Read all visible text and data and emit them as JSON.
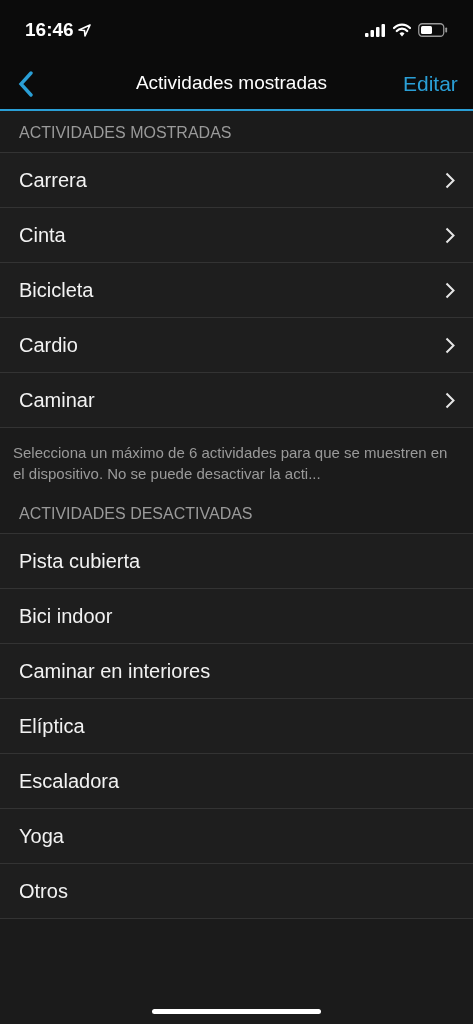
{
  "status_bar": {
    "time": "16:46"
  },
  "nav_bar": {
    "title": "Actividades mostradas",
    "action": "Editar"
  },
  "sections": [
    {
      "header": "ACTIVIDADES MOSTRADAS",
      "footer": "Selecciona un máximo de 6 actividades para que se muestren en el dispositivo. No se puede desactivar la acti...",
      "items": [
        {
          "label": "Carrera",
          "kind": "link"
        },
        {
          "label": "Cinta",
          "kind": "link"
        },
        {
          "label": "Bicicleta",
          "kind": "link"
        },
        {
          "label": "Cardio",
          "kind": "link"
        },
        {
          "label": "Caminar",
          "kind": "link"
        }
      ]
    },
    {
      "header": "ACTIVIDADES DESACTIVADAS",
      "items": [
        {
          "label": "Pista cubierta",
          "kind": "plain"
        },
        {
          "label": "Bici indoor",
          "kind": "plain"
        },
        {
          "label": "Caminar en interiores",
          "kind": "plain"
        },
        {
          "label": "Elíptica",
          "kind": "plain"
        },
        {
          "label": "Escaladora",
          "kind": "plain"
        },
        {
          "label": "Yoga",
          "kind": "plain"
        },
        {
          "label": "Otros",
          "kind": "plain"
        }
      ]
    }
  ]
}
